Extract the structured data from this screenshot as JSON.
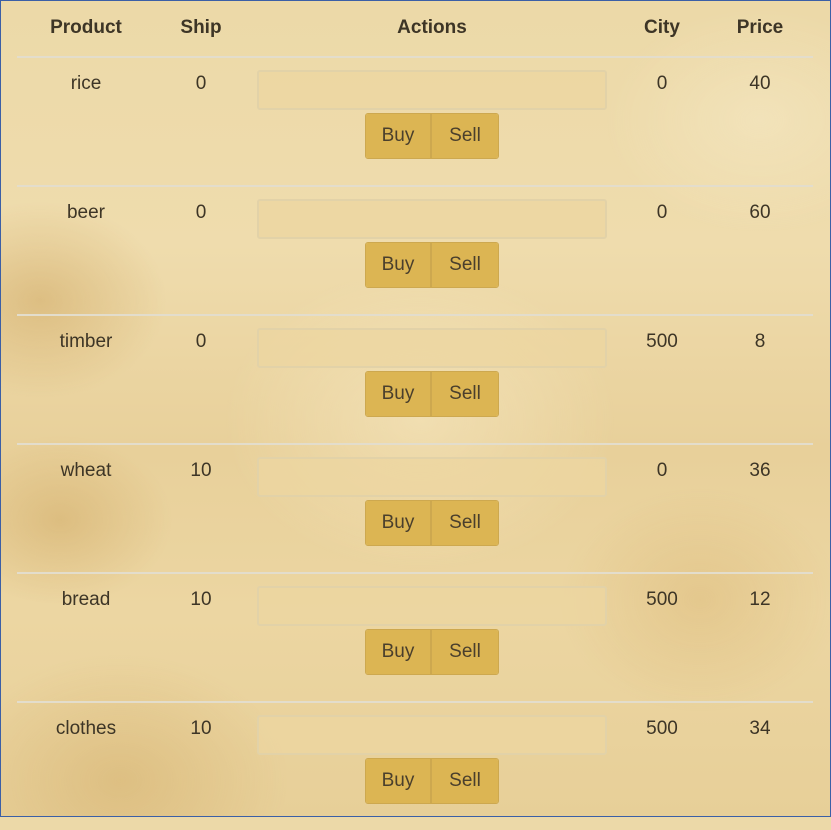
{
  "headers": {
    "product": "Product",
    "ship": "Ship",
    "actions": "Actions",
    "city": "City",
    "price": "Price"
  },
  "buttons": {
    "buy": "Buy",
    "sell": "Sell"
  },
  "rows": [
    {
      "product": "rice",
      "ship": "0",
      "qty": "",
      "city": "0",
      "price": "40"
    },
    {
      "product": "beer",
      "ship": "0",
      "qty": "",
      "city": "0",
      "price": "60"
    },
    {
      "product": "timber",
      "ship": "0",
      "qty": "",
      "city": "500",
      "price": "8"
    },
    {
      "product": "wheat",
      "ship": "10",
      "qty": "",
      "city": "0",
      "price": "36"
    },
    {
      "product": "bread",
      "ship": "10",
      "qty": "",
      "city": "500",
      "price": "12"
    },
    {
      "product": "clothes",
      "ship": "10",
      "qty": "",
      "city": "500",
      "price": "34"
    }
  ],
  "colors": {
    "button_bg": "#dcb553",
    "frame_border": "#3b5fa6",
    "divider": "#e3ddcc"
  }
}
